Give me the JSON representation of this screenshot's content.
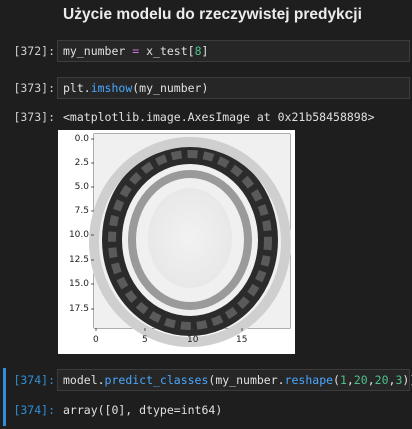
{
  "heading": "Użycie modelu do rzeczywistej predykcji",
  "cells": [
    {
      "prompt": "[372]:",
      "code": {
        "a": "my_number ",
        "op": "=",
        "b": " x_test[",
        "num": "8",
        "c": "]"
      }
    },
    {
      "prompt": "[373]:",
      "code": {
        "a": "plt.",
        "fn": "imshow",
        "b": "(my_number)"
      }
    },
    {
      "out_prompt": "[373]:",
      "output": "<matplotlib.image.AxesImage at 0x21b58458898>"
    },
    {
      "prompt": "[374]:",
      "code": {
        "a": "model.",
        "fn1": "predict_classes",
        "b": "(my_number.",
        "fn2": "reshape",
        "c": "(",
        "n1": "1",
        "d": ",",
        "n2": "20",
        "e": ",",
        "n3": "20",
        "f": ",",
        "n4": "3",
        "g": "))"
      }
    },
    {
      "out_prompt": "[374]:",
      "output": "array([0], dtype=int64)"
    }
  ],
  "plot": {
    "yticks": [
      "0.0",
      "2.5",
      "5.0",
      "7.5",
      "10.0",
      "12.5",
      "15.0",
      "17.5"
    ],
    "xticks": [
      "0",
      "5",
      "10",
      "15"
    ]
  },
  "colors": {
    "accent": "#2f8fd8",
    "number": "#4fc08d",
    "function": "#4aa8ff",
    "operator": "#c678dd"
  }
}
